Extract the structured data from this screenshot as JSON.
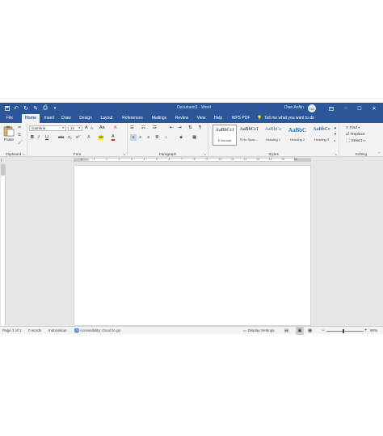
{
  "titlebar": {
    "doc_title": "Document1 - Word",
    "user_name": "Dian Anfiin",
    "user_initials": "DA",
    "qat_icons": [
      "save-icon",
      "undo-icon",
      "redo-icon",
      "pen-icon",
      "print-preview-icon",
      "customize-qat-icon"
    ],
    "window_controls": [
      "ribbon-display-icon",
      "minimize-icon",
      "maximize-icon",
      "close-icon"
    ]
  },
  "tabs": [
    "File",
    "Home",
    "Insert",
    "Draw",
    "Design",
    "Layout",
    "References",
    "Mailings",
    "Review",
    "View",
    "Help",
    "WPS PDF"
  ],
  "active_tab": "Home",
  "tell_me": "Tell me what you want to do",
  "ribbon": {
    "clipboard": {
      "label": "Clipboard",
      "paste": "Paste"
    },
    "font": {
      "label": "Font",
      "name": "Cambria",
      "size": "12",
      "row1": [
        "A",
        "A",
        "Aa",
        "A"
      ],
      "row2": [
        "B",
        "I",
        "U",
        "abc",
        "x₂",
        "x²",
        "A",
        "ab",
        "A"
      ]
    },
    "paragraph": {
      "label": "Paragraph",
      "pilcrow": "¶"
    },
    "styles": {
      "label": "Styles",
      "items": [
        {
          "preview": "AaBbCcI",
          "name": "¶ Normal"
        },
        {
          "preview": "AaBbCcI",
          "name": "¶ No Spac..."
        },
        {
          "preview": "AaBbCc",
          "name": "Heading 1"
        },
        {
          "preview": "AaBbC",
          "name": "Heading 2"
        },
        {
          "preview": "AaBbCc",
          "name": "Heading 3"
        }
      ]
    },
    "editing": {
      "label": "Editing",
      "find": "Find",
      "replace": "Replace",
      "select": "Select"
    }
  },
  "ruler": {
    "numbers": [
      "2",
      "1",
      "1",
      "2",
      "3",
      "4",
      "5",
      "6",
      "7",
      "8",
      "9",
      "10",
      "11",
      "12",
      "13",
      "14",
      "15",
      "16"
    ]
  },
  "statusbar": {
    "page": "Page 1 of 1",
    "words": "0 words",
    "language": "Indonesian",
    "accessibility": "Accessibility: Good to go",
    "display_settings": "Display Settings",
    "zoom_minus": "−",
    "zoom_plus": "+",
    "zoom": "90%",
    "zoom_fraction": 0.45
  },
  "colors": {
    "accent": "#2b579a",
    "ribbon": "#f3f3f3",
    "canvas": "#e6e6e6"
  }
}
